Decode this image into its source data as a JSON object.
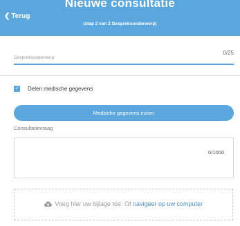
{
  "header": {
    "back_label": "Terug",
    "title": "Nieuwe consultatie",
    "subtitle": "(stap 2 van 2 Gespreksonderwerp)"
  },
  "subject_field": {
    "placeholder": "Gespreksonderwerp",
    "counter": "0/25"
  },
  "share_checkbox": {
    "label": "Delen medische gegevens",
    "checked": true
  },
  "medical_button": {
    "label": "Medische gegevens inzien"
  },
  "question_field": {
    "label": "Consultatievraag",
    "counter": "0/1000"
  },
  "attachment": {
    "text": "Voeg hier uw bijlage toe. Of",
    "link": "navigeer op uw computer",
    "icon": "cloud-upload-icon"
  },
  "colors": {
    "accent": "#5aa6dd",
    "link": "#4b8fd0"
  }
}
